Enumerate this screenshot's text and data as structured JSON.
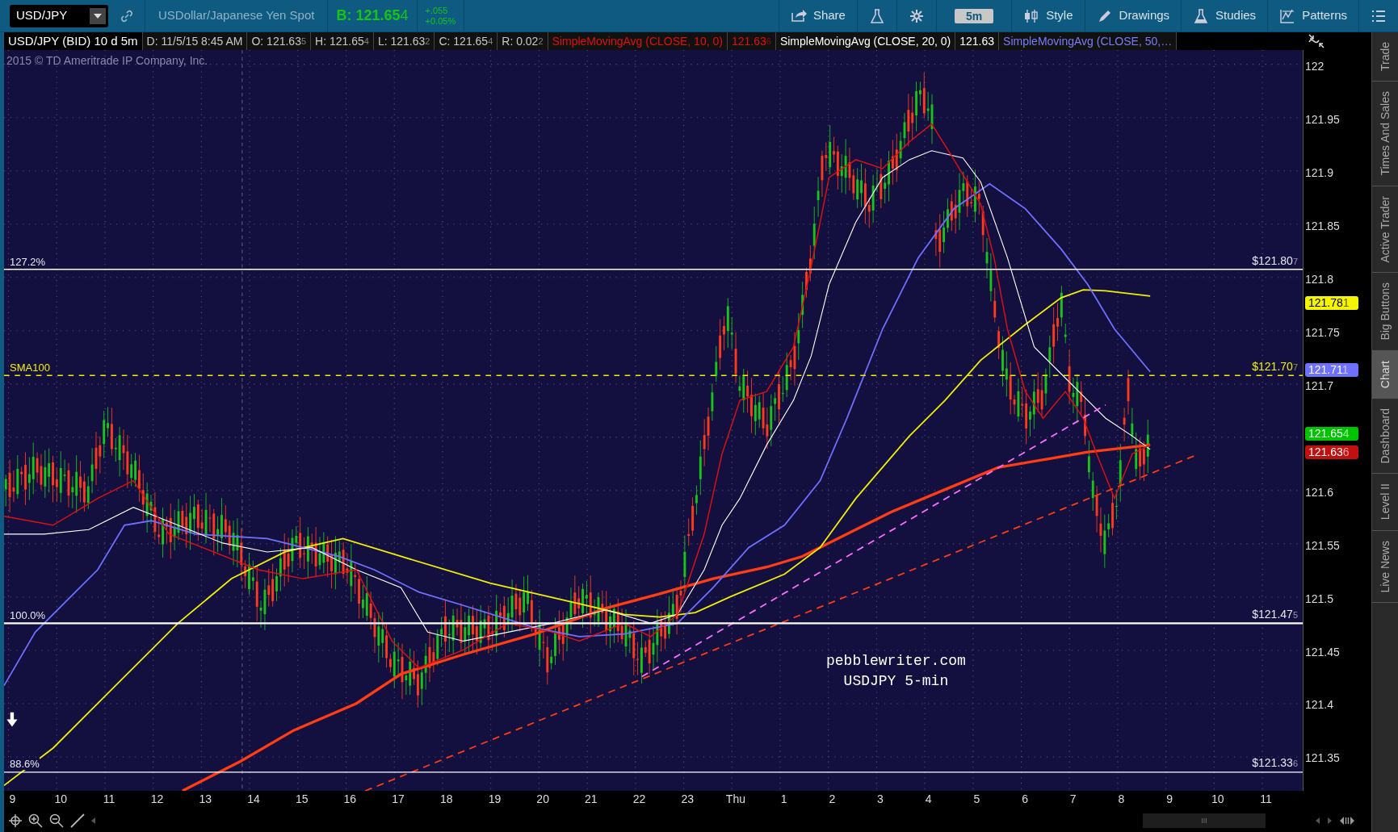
{
  "toolbar": {
    "symbol": "USD/JPY",
    "description": "USDollar/Japanese Yen Spot",
    "bid": {
      "main": "B: 121.65",
      "pip": "4"
    },
    "change": "+.055",
    "change_percent": "+0.05%",
    "buttons": [
      {
        "kind": "share",
        "label": "Share"
      },
      {
        "kind": "flask"
      },
      {
        "kind": "gear"
      },
      {
        "kind": "interval",
        "label": "5m"
      },
      {
        "kind": "style",
        "label": "Style"
      },
      {
        "kind": "drawings",
        "label": "Drawings"
      },
      {
        "kind": "studies",
        "label": "Studies"
      },
      {
        "kind": "patterns",
        "label": "Patterns"
      },
      {
        "kind": "menu"
      }
    ]
  },
  "info_bar": [
    {
      "main": "USD/JPY (BID) 10 d 5m",
      "kind": "symbol"
    },
    {
      "main": "D: 11/5/15 8:45 AM",
      "kind": "stat"
    },
    {
      "main": "O: 121.63",
      "pip": "5",
      "kind": "stat"
    },
    {
      "main": "H: 121.65",
      "pip": "4",
      "kind": "stat"
    },
    {
      "main": "L: 121.63",
      "pip": "2",
      "kind": "stat"
    },
    {
      "main": "C: 121.65",
      "pip": "4",
      "kind": "stat"
    },
    {
      "main": "R: 0.02",
      "pip": "2",
      "kind": "stat"
    },
    {
      "main": "SimpleMovingAvg (CLOSE, 10, 0)",
      "kind": "sma10"
    },
    {
      "main": "121.63",
      "pip": "6",
      "kind": "sma10"
    },
    {
      "main": "SimpleMovingAvg (CLOSE, 20, 0)",
      "kind": "sma20"
    },
    {
      "main": "121.63",
      "kind": "sma20"
    },
    {
      "main": "SimpleMovingAvg (CLOSE, 50,…",
      "kind": "sma50"
    }
  ],
  "chart": {
    "copyright": "2015 © TD Ameritrade IP Company, Inc.",
    "levels": [
      {
        "kind": "fib",
        "label": "127.2%",
        "price": {
          "main": "$121.80",
          "pip": "7"
        }
      },
      {
        "kind": "sma",
        "label": "SMA100",
        "price": {
          "main": "$121.70",
          "pip": "7"
        }
      },
      {
        "kind": "fib",
        "label": "100.0%",
        "price": {
          "main": "$121.47",
          "pip": "5"
        }
      },
      {
        "kind": "fib",
        "label": "88.6%",
        "price": {
          "main": "$121.33",
          "pip": "6"
        }
      }
    ],
    "annotation": [
      "pebblewriter.com",
      "USDJPY 5-min"
    ]
  },
  "y_axis": {
    "ticks": [
      "122",
      "121.95",
      "121.9",
      "121.85",
      "121.8",
      "121.75",
      "121.7",
      "121.6",
      "121.55",
      "121.5",
      "121.45",
      "121.4",
      "121.35"
    ],
    "tags": [
      {
        "main": "121.78",
        "pip": "1",
        "color": "#f5f500"
      },
      {
        "main": "121.71",
        "pip": "1",
        "color": "#7070ff"
      },
      {
        "main": "121.65",
        "pip": "4",
        "color": "#00c400"
      },
      {
        "main": "121.63",
        "pip": "6",
        "color": "#c01010"
      }
    ]
  },
  "x_axis": {
    "labels": [
      "9",
      "10",
      "11",
      "12",
      "13",
      "14",
      "15",
      "16",
      "17",
      "18",
      "19",
      "20",
      "21",
      "22",
      "23",
      "Thu",
      "1",
      "2",
      "3",
      "4",
      "5",
      "6",
      "7",
      "8",
      "9",
      "10",
      "11"
    ]
  },
  "side_tabs": [
    {
      "label": "Trade",
      "selected": false
    },
    {
      "label": "Times And Sales",
      "selected": false
    },
    {
      "label": "Active Trader",
      "selected": false
    },
    {
      "label": "Big Buttons",
      "selected": false
    },
    {
      "label": "Chart",
      "selected": true
    },
    {
      "label": "Dashboard",
      "selected": false
    },
    {
      "label": "Level II",
      "selected": false
    },
    {
      "label": "Live News",
      "selected": false
    }
  ]
}
